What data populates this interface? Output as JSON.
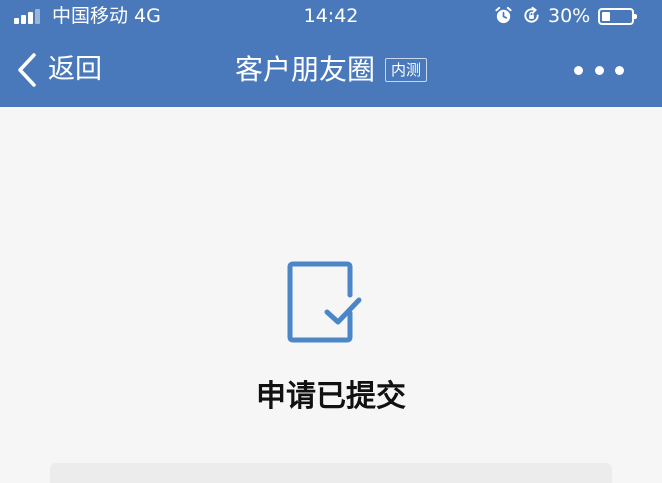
{
  "status_bar": {
    "carrier": "中国移动 4G",
    "time": "14:42",
    "battery": "30%",
    "battery_level": 0.3
  },
  "nav": {
    "back_label": "返回",
    "title": "客户朋友圈",
    "badge": "内测",
    "more_icon": "more-dots-icon"
  },
  "content": {
    "icon": "document-check-icon",
    "message": "申请已提交"
  },
  "colors": {
    "header": "#4a79bb",
    "accent": "#4a86c8",
    "background": "#f6f6f6"
  }
}
